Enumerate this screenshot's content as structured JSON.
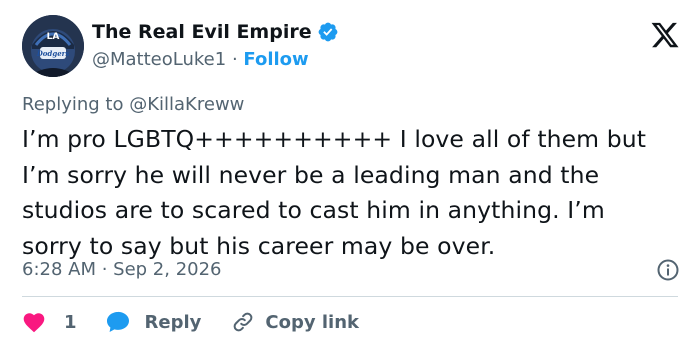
{
  "author": {
    "display_name": "The Real Evil Empire",
    "handle": "@MatteoLuke1",
    "separator": "·",
    "follow_label": "Follow",
    "avatar_text": "Dodgers"
  },
  "replying": {
    "prefix": "Replying to",
    "mention": "@KillaKreww"
  },
  "tweet": {
    "text": "I’m pro LGBTQ++++++++++ I love all of them but I’m sorry he will never be a leading man and the studios are to scared to cast him in anything. I’m sorry to say but his career may be over.",
    "timestamp": "6:28 AM · Sep 2, 2026"
  },
  "actions": {
    "like_count": "1",
    "reply_label": "Reply",
    "copy_label": "Copy link"
  },
  "colors": {
    "accent": "#1d9bf0",
    "like": "#f91880",
    "text": "#0f1419",
    "muted": "#536471",
    "divider": "#cfd9de"
  },
  "icons": [
    "verified-badge-icon",
    "x-logo-icon",
    "info-icon",
    "heart-icon",
    "reply-bubble-icon",
    "link-icon"
  ]
}
